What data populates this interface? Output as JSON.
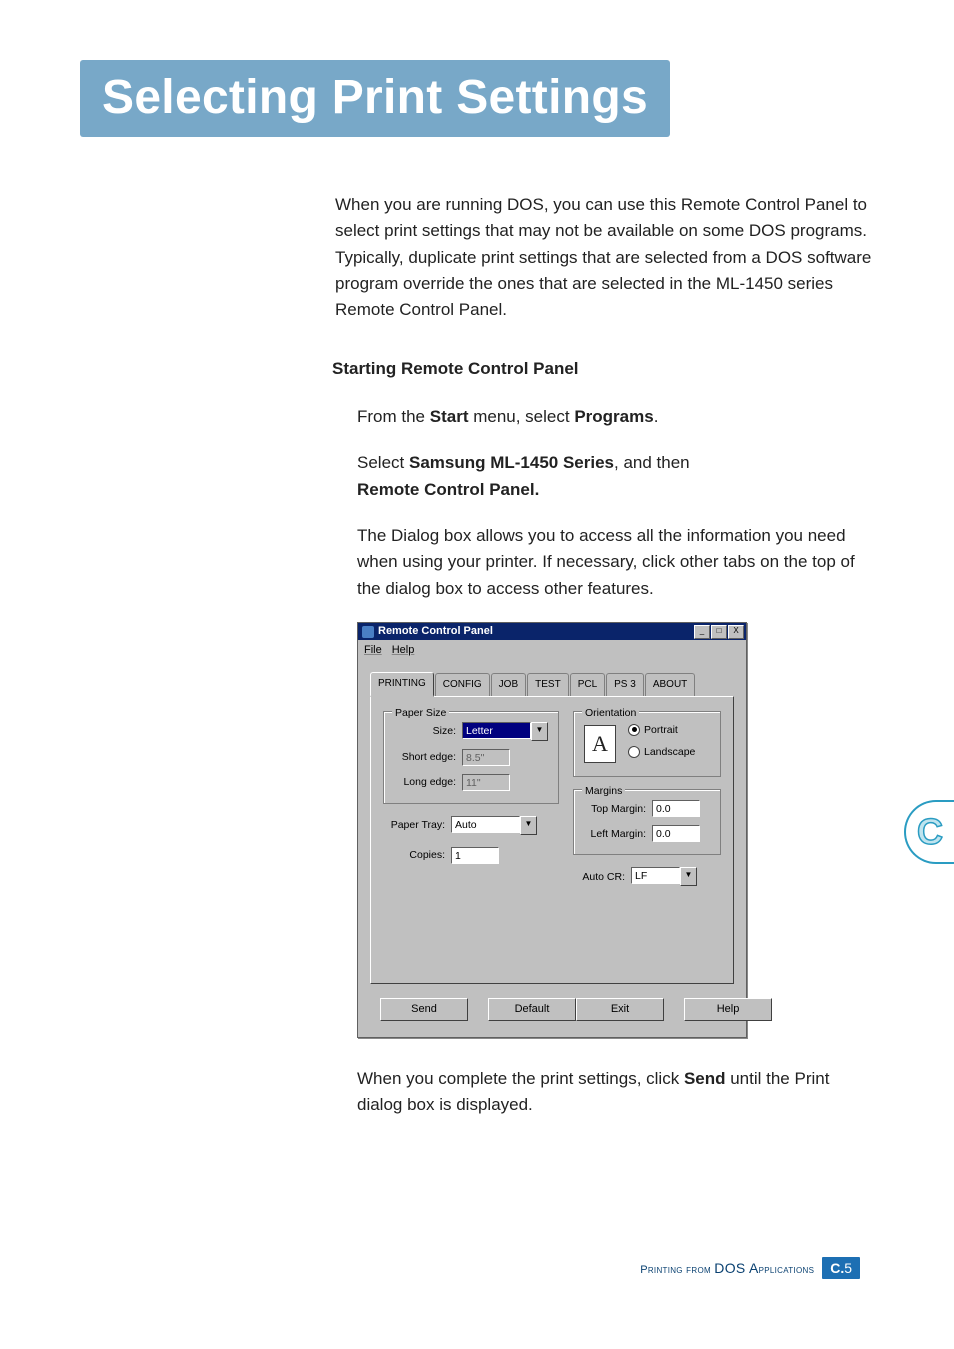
{
  "heading": "Selecting Print Settings",
  "intro": "When you are running DOS, you can use this Remote Control Panel to select print settings that may not be available on some DOS programs. Typically, duplicate print settings that are selected from a DOS software program override the ones that are selected in the ML-1450 series Remote Control Panel.",
  "section_heading": "Starting Remote Control Panel",
  "steps": {
    "s1_a": "From the ",
    "s1_b": "Start",
    "s1_c": " menu, select ",
    "s1_d": "Programs",
    "s1_e": ".",
    "s2_a": "Select ",
    "s2_b": "Samsung ML-1450 Series",
    "s2_c": ", and then ",
    "s2_d": "Remote Control Panel.",
    "s3": "The Dialog box allows you to access all the information you need when using your printer. If necessary, click other tabs on the top of the dialog box to access other features.",
    "s4_a": "When you complete the print settings, click ",
    "s4_b": "Send",
    "s4_c": " until the Print dialog box is displayed."
  },
  "dialog": {
    "title": "Remote Control Panel",
    "menu": {
      "file": "File",
      "help": "Help"
    },
    "tabs": [
      "PRINTING",
      "CONFIG",
      "JOB",
      "TEST",
      "PCL",
      "PS 3",
      "ABOUT"
    ],
    "paper_size": {
      "legend": "Paper Size",
      "size_label": "Size:",
      "size_value": "Letter",
      "short_edge_label": "Short edge:",
      "short_edge_value": "8.5\"",
      "long_edge_label": "Long edge:",
      "long_edge_value": "11\""
    },
    "orientation": {
      "legend": "Orientation",
      "preview_glyph": "A",
      "portrait": "Portrait",
      "landscape": "Landscape"
    },
    "paper_tray_label": "Paper Tray:",
    "paper_tray_value": "Auto",
    "copies_label": "Copies:",
    "copies_value": "1",
    "margins": {
      "legend": "Margins",
      "top_label": "Top Margin:",
      "top_value": "0.0",
      "left_label": "Left Margin:",
      "left_value": "0.0"
    },
    "autocr_label": "Auto CR:",
    "autocr_value": "LF",
    "buttons": {
      "send": "Send",
      "default": "Default",
      "exit": "Exit",
      "help": "Help"
    },
    "win_buttons": {
      "min": "_",
      "max": "□",
      "close": "X"
    }
  },
  "footer": {
    "label_a": "Printing from ",
    "label_b": "DOS A",
    "label_c": "pplications",
    "page_prefix": "C.",
    "page_num": "5"
  },
  "side_tab": "C"
}
